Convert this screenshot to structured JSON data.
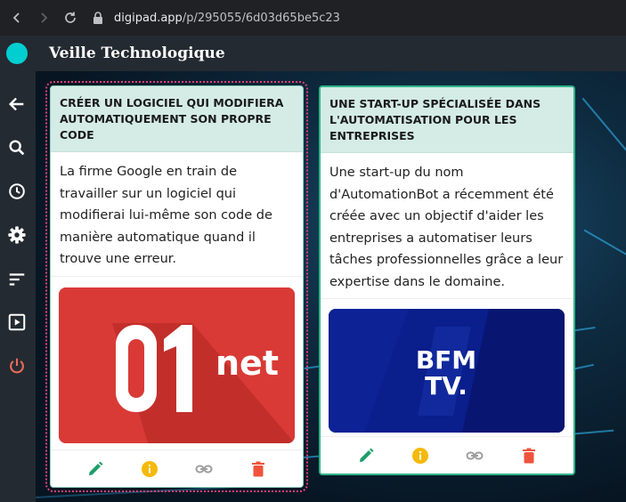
{
  "browser": {
    "url_host": "digipad.app",
    "url_path": "/p/295055/6d03d65be5c23"
  },
  "app": {
    "title": "Veille Technologique"
  },
  "sidebar": {
    "items": [
      {
        "icon": "back-arrow-icon"
      },
      {
        "icon": "search-icon"
      },
      {
        "icon": "history-clock-icon"
      },
      {
        "icon": "gear-icon"
      },
      {
        "icon": "sort-icon"
      },
      {
        "icon": "play-icon"
      },
      {
        "icon": "power-icon"
      }
    ]
  },
  "cards": [
    {
      "title": "Créer un logiciel qui modifiera automatiquement son propre code",
      "text": "La firme Google en train de travailler sur un logiciel qui modifierai lui-même son code de manière automatique quand il trouve une erreur.",
      "logo_big": "01",
      "logo_small": "net",
      "color": "#d93a36"
    },
    {
      "title": "Une start-up spécialisée dans l'automatisation pour les entreprises",
      "text": "Une start-up du nom d'AutomationBot a récemment été créée avec un objectif d'aider les entreprises a automatiser leurs tâches professionnelles grâce a leur expertise dans le domaine.",
      "logo_line1": "BFM",
      "logo_line2": "TV.",
      "color": "#0a1e8c"
    }
  ],
  "colors": {
    "edit": "#1e9e6a",
    "info": "#f5b90a",
    "link": "#9e9e9e",
    "delete": "#f0533c",
    "power": "#ec6a5a",
    "accent": "#00ced1"
  }
}
